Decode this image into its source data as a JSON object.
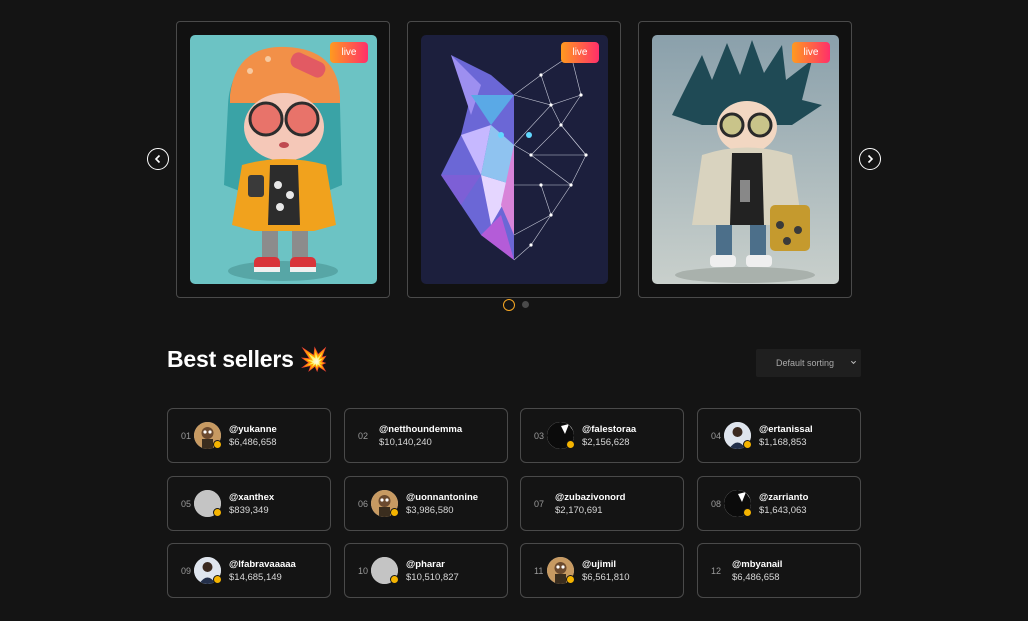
{
  "carousel": {
    "cards": [
      {
        "badge": "live",
        "art": "girl-figure-art"
      },
      {
        "badge": "live",
        "art": "wolf-polygon-art"
      },
      {
        "badge": "live",
        "art": "punk-boy-art"
      }
    ],
    "prev_icon": "chevron-left-icon",
    "next_icon": "chevron-right-icon",
    "dots": 2,
    "active_dot": 1
  },
  "best_sellers": {
    "title": "Best sellers 💥",
    "sort_label": "Default sorting",
    "sellers": [
      {
        "rank": "01",
        "handle": "@yukanne",
        "amount": "$6,486,658",
        "avatar": "figure",
        "verified": true
      },
      {
        "rank": "02",
        "handle": "@netthoundemma",
        "amount": "$10,140,240",
        "avatar": "none",
        "verified": false
      },
      {
        "rank": "03",
        "handle": "@falestoraa",
        "amount": "$2,156,628",
        "avatar": "dark",
        "verified": true
      },
      {
        "rank": "04",
        "handle": "@ertanissal",
        "amount": "$1,168,853",
        "avatar": "person",
        "verified": true
      },
      {
        "rank": "05",
        "handle": "@xanthex",
        "amount": "$839,349",
        "avatar": "grey",
        "verified": true
      },
      {
        "rank": "06",
        "handle": "@uonnantonine",
        "amount": "$3,986,580",
        "avatar": "figure",
        "verified": true
      },
      {
        "rank": "07",
        "handle": "@zubazivonord",
        "amount": "$2,170,691",
        "avatar": "none",
        "verified": false
      },
      {
        "rank": "08",
        "handle": "@zarrianto",
        "amount": "$1,643,063",
        "avatar": "dark",
        "verified": true
      },
      {
        "rank": "09",
        "handle": "@lfabravaaaaa",
        "amount": "$14,685,149",
        "avatar": "person",
        "verified": true
      },
      {
        "rank": "10",
        "handle": "@pharar",
        "amount": "$10,510,827",
        "avatar": "grey",
        "verified": true
      },
      {
        "rank": "11",
        "handle": "@ujimil",
        "amount": "$6,561,810",
        "avatar": "figure",
        "verified": true
      },
      {
        "rank": "12",
        "handle": "@mbyanail",
        "amount": "$6,486,658",
        "avatar": "none",
        "verified": false
      }
    ]
  },
  "colors": {
    "accent": "#f5a623",
    "live_from": "#ff9a1f",
    "live_to": "#ff2f6a",
    "background": "#141414"
  }
}
